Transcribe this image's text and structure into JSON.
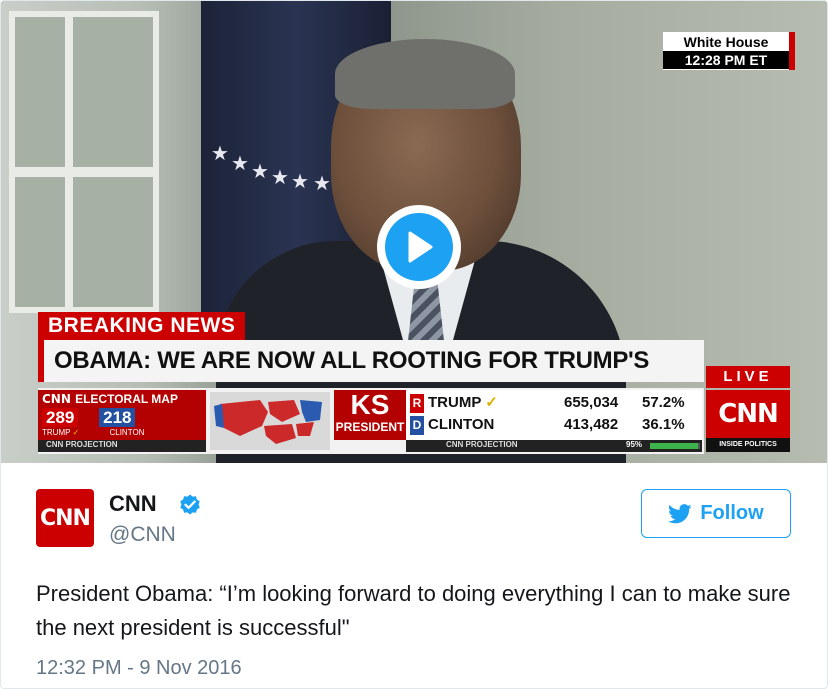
{
  "video": {
    "location_bug": {
      "place": "White House",
      "time": "12:28 PM ET"
    },
    "breaking_label": "BREAKING NEWS",
    "headline": "OBAMA: WE ARE NOW ALL ROOTING FOR TRUMP'S SUCCESS",
    "live_label": "LIVE",
    "network_logo": "CNN",
    "network_sub": "INSIDE POLITICS",
    "ticker": {
      "map_title": "ELECTORAL MAP",
      "trump_ev": "289",
      "clinton_ev": "218",
      "trump_sub": "TRUMP",
      "clinton_sub": "CLINTON",
      "map_projection": "CNN PROJECTION",
      "state": "KS",
      "race": "PRESIDENT",
      "candidates": [
        {
          "party": "R",
          "name": "TRUMP",
          "votes": "655,034",
          "pct": "57.2%",
          "party_color": "#cc0000"
        },
        {
          "party": "D",
          "name": "CLINTON",
          "votes": "413,482",
          "pct": "36.1%",
          "party_color": "#2350a0"
        }
      ],
      "race_projection": "CNN PROJECTION",
      "reported": "95%",
      "reported_fraction": 0.95
    },
    "play_icon": "play-icon"
  },
  "tweet": {
    "avatar_text": "CNN",
    "display_name": "CNN",
    "verified_icon": "verified-badge-icon",
    "handle": "@CNN",
    "follow_label": "Follow",
    "follow_icon": "twitter-bird-icon",
    "text": "President Obama: “I’m looking forward to doing everything I can to make sure the next president is successful\"",
    "timestamp": "12:32 PM - 9 Nov 2016"
  },
  "colors": {
    "cnn_red": "#cc0000",
    "twitter_blue": "#1da1f2",
    "text": "#14171a",
    "muted": "#657786"
  }
}
